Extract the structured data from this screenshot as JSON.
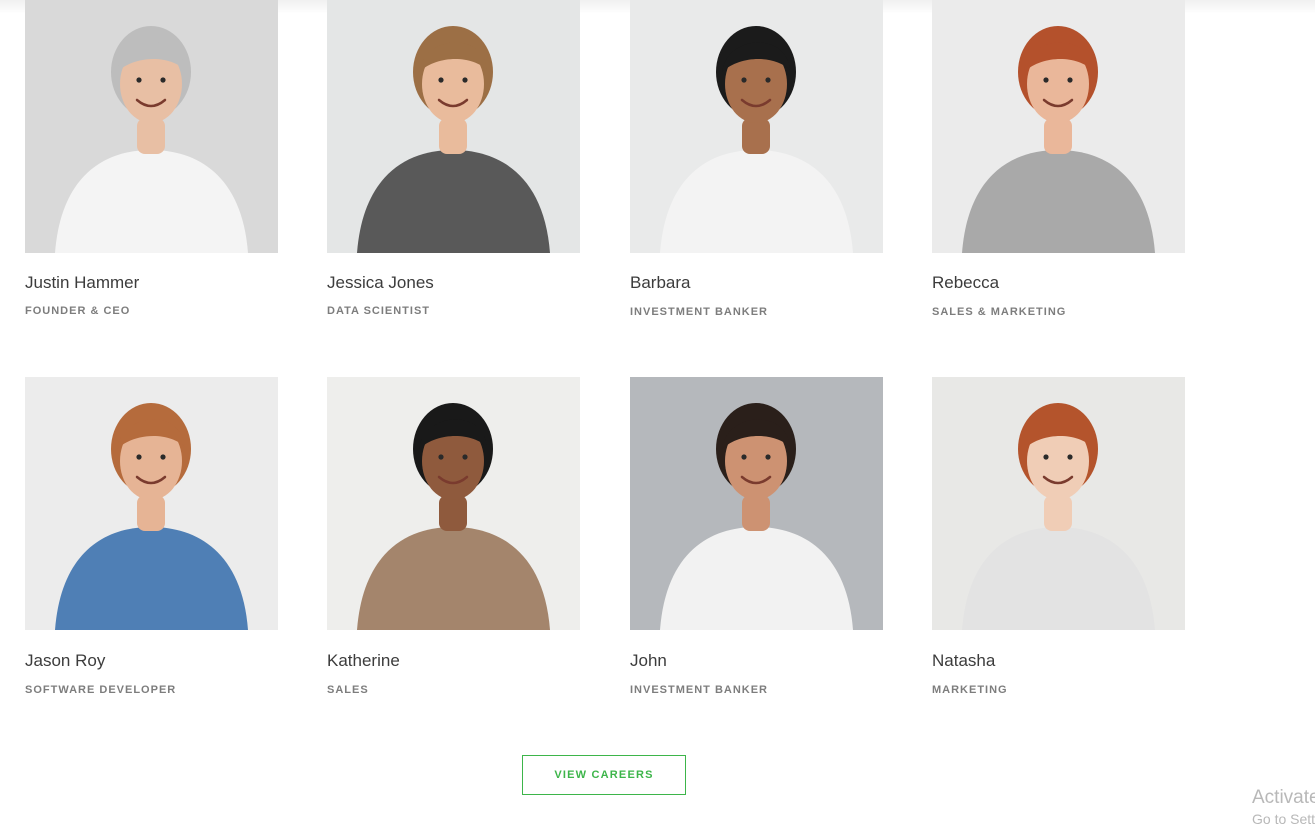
{
  "team": {
    "members": [
      {
        "name": "Justin Hammer",
        "role": "FOUNDER & CEO",
        "photo": "portrait-older-man-glasses-white-shirt-arms-crossed",
        "bg": "#d9d9d9",
        "skin": "#e8bfa4",
        "hair": "#bdbdbd",
        "shirt": "#f4f4f4"
      },
      {
        "name": "Jessica Jones",
        "role": "DATA SCIENTIST",
        "photo": "portrait-woman-blonde-bob-gray-tshirt",
        "bg": "#e4e6e6",
        "skin": "#e9bb9c",
        "hair": "#9c6f45",
        "shirt": "#595959"
      },
      {
        "name": "Barbara",
        "role": "INVESTMENT BANKER",
        "photo": "portrait-woman-curly-hair-glasses-white-tshirt",
        "bg": "#e9eaea",
        "skin": "#a8704d",
        "hair": "#1b1b1b",
        "shirt": "#f3f3f3"
      },
      {
        "name": "Rebecca",
        "role": "SALES & MARKETING",
        "photo": "portrait-woman-red-bun-gray-tshirt",
        "bg": "#ebebeb",
        "skin": "#eab79a",
        "hair": "#b4512c",
        "shirt": "#a9a9a9"
      },
      {
        "name": "Jason Roy",
        "role": "SOFTWARE DEVELOPER",
        "photo": "portrait-man-ginger-beard-denim-shirt",
        "bg": "#ececec",
        "skin": "#e6b495",
        "hair": "#b56b3c",
        "shirt": "#4f7fb5"
      },
      {
        "name": "Katherine",
        "role": "SALES",
        "photo": "portrait-woman-curly-hair-beige-top",
        "bg": "#eeeeec",
        "skin": "#8f5a3d",
        "hair": "#191919",
        "shirt": "#a4856c"
      },
      {
        "name": "John",
        "role": "INVESTMENT BANKER",
        "photo": "portrait-man-dark-hair-white-tshirt-arms-crossed",
        "bg": "#b5b8bc",
        "skin": "#cd9272",
        "hair": "#2a1f1a",
        "shirt": "#f2f2f2"
      },
      {
        "name": "Natasha",
        "role": "MARKETING",
        "photo": "portrait-woman-red-hair-striped-top",
        "bg": "#e8e8e6",
        "skin": "#f0cdb6",
        "hair": "#b4542c",
        "shirt": "#e3e3e3"
      }
    ]
  },
  "cta": {
    "label": "VIEW CAREERS"
  },
  "watermark": {
    "title": "Activate",
    "subtitle": "Go to Settings"
  },
  "colors": {
    "accent": "#3db54a",
    "name_text": "#3c3c3c",
    "role_text": "#7d7d7d"
  }
}
